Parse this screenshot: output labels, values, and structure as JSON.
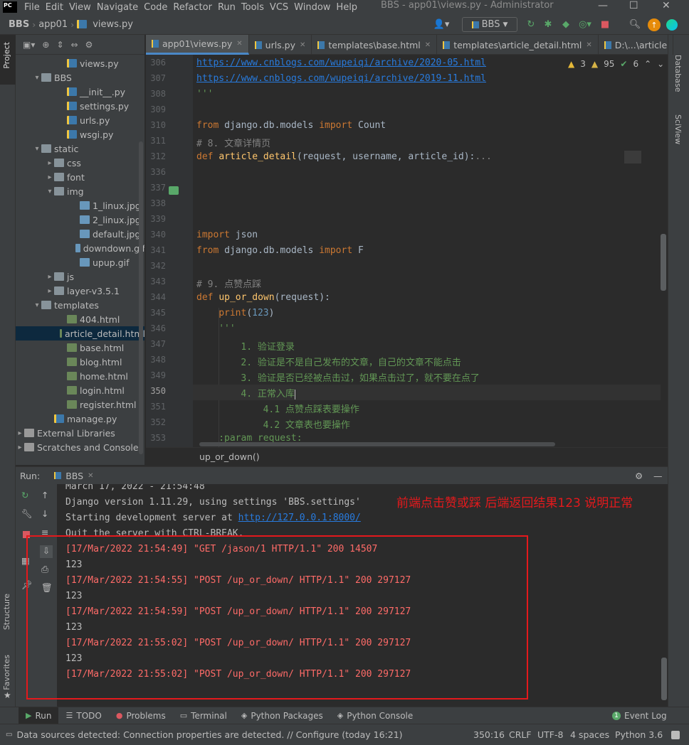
{
  "menubar": {
    "logo": "PC",
    "items": [
      "File",
      "Edit",
      "View",
      "Navigate",
      "Code",
      "Refactor",
      "Run",
      "Tools",
      "VCS",
      "Window",
      "Help"
    ],
    "window_title": "BBS - app01\\views.py - Administrator",
    "min": "—",
    "max": "☐",
    "close": "✕"
  },
  "navbar": {
    "crumbs": [
      "BBS",
      "app01",
      "views.py"
    ],
    "run_config": "BBS"
  },
  "side_tabs": {
    "project": "Project",
    "structure": "Structure",
    "favorites": "Favorites",
    "database": "Database",
    "sciview": "SciView"
  },
  "tree": [
    {
      "label": "views.py",
      "type": "py",
      "depth": 4
    },
    {
      "label": "BBS",
      "type": "folder",
      "depth": 2,
      "arrow": "▾"
    },
    {
      "label": "__init__.py",
      "type": "py",
      "depth": 4
    },
    {
      "label": "settings.py",
      "type": "py",
      "depth": 4
    },
    {
      "label": "urls.py",
      "type": "py",
      "depth": 4
    },
    {
      "label": "wsgi.py",
      "type": "py",
      "depth": 4
    },
    {
      "label": "static",
      "type": "folder",
      "depth": 2,
      "arrow": "▾"
    },
    {
      "label": "css",
      "type": "folder",
      "depth": 3,
      "arrow": "▸"
    },
    {
      "label": "font",
      "type": "folder",
      "depth": 3,
      "arrow": "▸"
    },
    {
      "label": "img",
      "type": "folder",
      "depth": 3,
      "arrow": "▾"
    },
    {
      "label": "1_linux.jpg",
      "type": "img",
      "depth": 5
    },
    {
      "label": "2_linux.jpg",
      "type": "img",
      "depth": 5
    },
    {
      "label": "default.jpg",
      "type": "img",
      "depth": 5
    },
    {
      "label": "downdown.gif",
      "type": "img",
      "depth": 5
    },
    {
      "label": "upup.gif",
      "type": "img",
      "depth": 5
    },
    {
      "label": "js",
      "type": "folder",
      "depth": 3,
      "arrow": "▸"
    },
    {
      "label": "layer-v3.5.1",
      "type": "folder",
      "depth": 3,
      "arrow": "▸"
    },
    {
      "label": "templates",
      "type": "folder",
      "depth": 2,
      "arrow": "▾"
    },
    {
      "label": "404.html",
      "type": "html",
      "depth": 4
    },
    {
      "label": "article_detail.html",
      "type": "html",
      "depth": 4,
      "selected": true
    },
    {
      "label": "base.html",
      "type": "html",
      "depth": 4
    },
    {
      "label": "blog.html",
      "type": "html",
      "depth": 4
    },
    {
      "label": "home.html",
      "type": "html",
      "depth": 4
    },
    {
      "label": "login.html",
      "type": "html",
      "depth": 4
    },
    {
      "label": "register.html",
      "type": "html",
      "depth": 4
    },
    {
      "label": "manage.py",
      "type": "py",
      "depth": 3
    },
    {
      "label": "External Libraries",
      "type": "lib",
      "depth": 1,
      "arrow": "▸"
    },
    {
      "label": "Scratches and Consoles",
      "type": "lib",
      "depth": 1,
      "arrow": "▸"
    }
  ],
  "tabs": [
    {
      "label": "app01\\views.py",
      "active": true
    },
    {
      "label": "urls.py"
    },
    {
      "label": "templates\\base.html"
    },
    {
      "label": "templates\\article_detail.html"
    },
    {
      "label": "D:\\...\\article"
    }
  ],
  "inspections": {
    "warnings": "3",
    "weak": "95",
    "ok": "6"
  },
  "line_numbers": [
    "306",
    "307",
    "308",
    "309",
    "310",
    "311",
    "312",
    "336",
    "337",
    "338",
    "339",
    "340",
    "341",
    "342",
    "343",
    "344",
    "345",
    "346",
    "347",
    "348",
    "349",
    "350",
    "351",
    "352",
    "353"
  ],
  "code": {
    "l306": "https://www.cnblogs.com/wupeiqi/archive/2020-05.html",
    "l307": "https://www.cnblogs.com/wupeiqi/archive/2019-11.html",
    "l308": "'''",
    "l310_kw1": "from",
    "l310_mod": " django.db.models ",
    "l310_kw2": "import",
    "l310_name": " Count",
    "l311": "# 8. 文章详情页",
    "l312_kw": "def",
    "l312_fn": "article_detail",
    "l312_args": "(request, username, article_id):",
    "l312_fold": "...",
    "l340_kw": "import",
    "l340_name": " json",
    "l341_kw1": "from",
    "l341_mod": " django.db.models ",
    "l341_kw2": "import",
    "l341_name": " F",
    "l343": "# 9. 点赞点踩",
    "l344_kw": "def",
    "l344_fn": "up_or_down",
    "l344_args": "(request):",
    "l345_fn": "print",
    "l345_open": "(",
    "l345_num": "123",
    "l345_close": ")",
    "l346": "'''",
    "l347": "1. 验证登录",
    "l348": "2. 验证是不是自己发布的文章，自己的文章不能点击",
    "l349": "3. 验证是否已经被点击过，如果点击过了，就不要在点了",
    "l350": "4. 正常入库",
    "l351": "4.1 点赞点踩表要操作",
    "l352": "4.2 文章表也要操作",
    "l353": ":param request:"
  },
  "editor_breadcrumb": "up_or_down()",
  "run": {
    "label": "Run:",
    "config": "BBS",
    "lines": [
      {
        "text": "March 17, 2022 - 21:54:48",
        "red": false
      },
      {
        "text": "Django version 1.11.29, using settings 'BBS.settings'",
        "red": false
      },
      {
        "text": "Starting development server at ",
        "red": false,
        "link": "http://127.0.0.1:8000/"
      },
      {
        "text": "Quit the server with CTRL-BREAK.",
        "red": false
      },
      {
        "text": "[17/Mar/2022 21:54:49] \"GET /jason/1 HTTP/1.1\" 200 14507",
        "red": true
      },
      {
        "text": "123",
        "red": false
      },
      {
        "text": "[17/Mar/2022 21:54:55] \"POST /up_or_down/ HTTP/1.1\" 200 297127",
        "red": true
      },
      {
        "text": "123",
        "red": false
      },
      {
        "text": "[17/Mar/2022 21:54:59] \"POST /up_or_down/ HTTP/1.1\" 200 297127",
        "red": true
      },
      {
        "text": "123",
        "red": false
      },
      {
        "text": "[17/Mar/2022 21:55:02] \"POST /up_or_down/ HTTP/1.1\" 200 297127",
        "red": true
      },
      {
        "text": "123",
        "red": false
      },
      {
        "text": "[17/Mar/2022 21:55:02] \"POST /up_or_down/ HTTP/1.1\" 200 297127",
        "red": true
      }
    ]
  },
  "annotation": "前端点击赞或踩 后端返回结果123 说明正常",
  "bottom_tabs": [
    "Run",
    "TODO",
    "Problems",
    "Terminal",
    "Python Packages",
    "Python Console"
  ],
  "event_log": "Event Log",
  "status": {
    "message": "Data sources detected: Connection properties are detected. // Configure (today 16:21)",
    "position": "350:16",
    "line_sep": "CRLF",
    "encoding": "UTF-8",
    "indent": "4 spaces",
    "interpreter": "Python 3.6"
  },
  "colors": {
    "accent": "#4a88c7",
    "annotation": "#e4191c",
    "log_red": "#ff6b68"
  }
}
